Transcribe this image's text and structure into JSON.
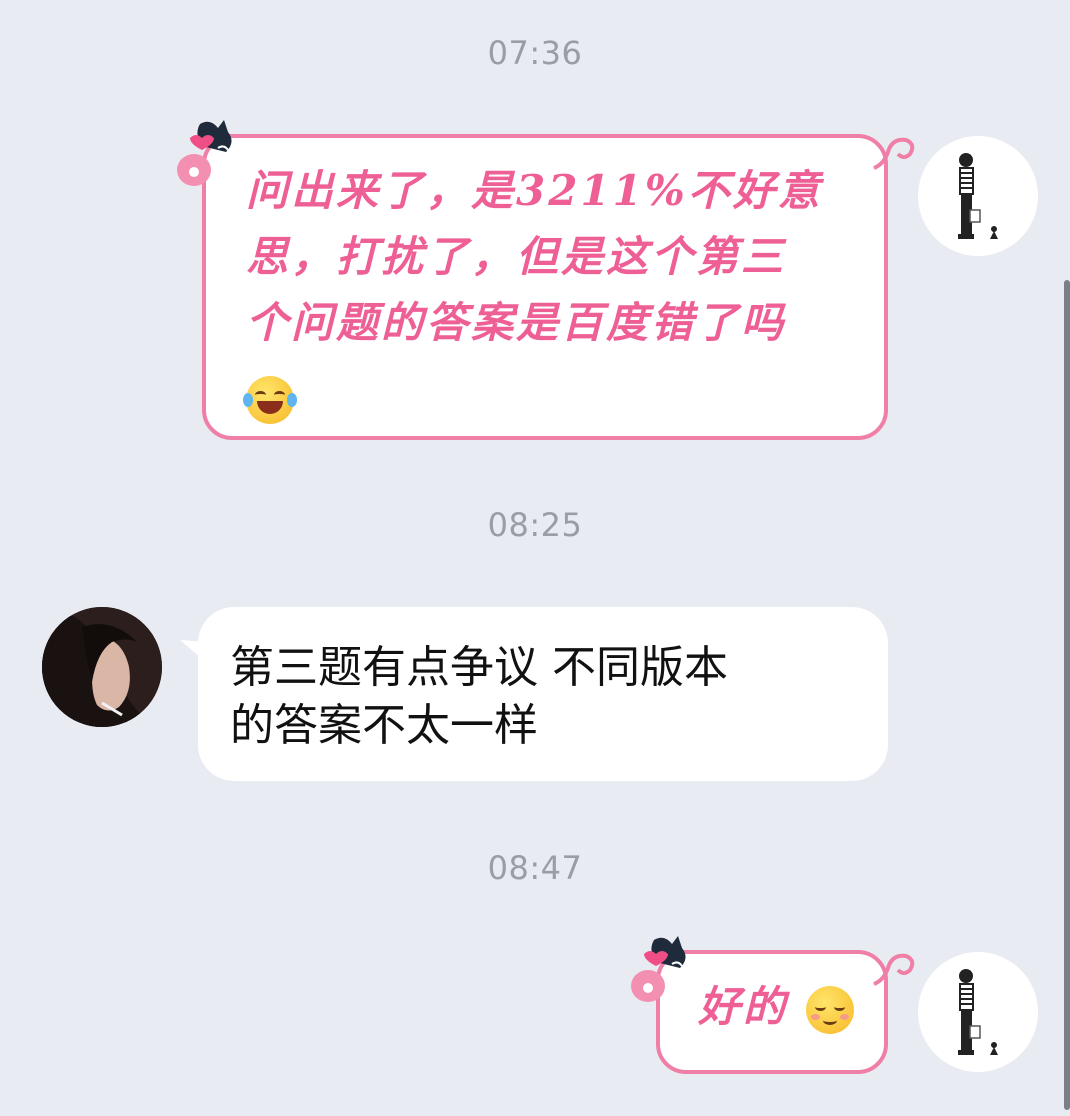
{
  "timestamps": [
    "07:36",
    "08:25",
    "08:47"
  ],
  "messages": [
    {
      "sender": "me",
      "text_lines": [
        "问出来了，是3211%不好意",
        "思，打扰了，但是这个第三",
        "个问题的答案是百度错了吗"
      ],
      "emoji": "face-with-tears-of-joy"
    },
    {
      "sender": "other",
      "text_lines": [
        "第三题有点争议 不同版本",
        "的答案不太一样"
      ]
    },
    {
      "sender": "me",
      "text": "好的",
      "emoji": "relieved-face"
    }
  ],
  "colors": {
    "background": "#e9ebf2",
    "pink_bubble_border": "#f07fa8",
    "pink_text": "#ee5f95",
    "timestamp": "#9a9ca6"
  }
}
